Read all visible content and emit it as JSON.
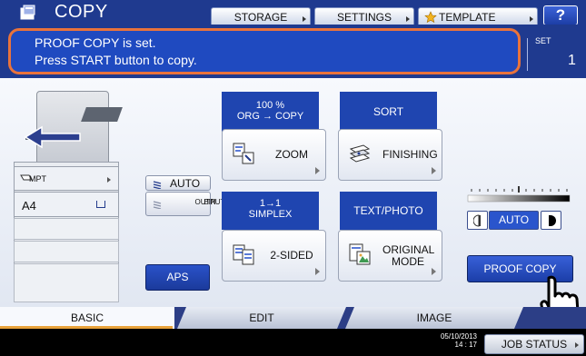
{
  "header": {
    "title": "COPY",
    "storage_label": "STORAGE",
    "settings_label": "SETTINGS",
    "template_label": "TEMPLATE",
    "help_label": "?"
  },
  "message": {
    "line1": "PROOF COPY is set.",
    "line2": "Press START button to copy.",
    "set_label": "SET",
    "set_count": "1"
  },
  "machine": {
    "tray_mpt": "MPT",
    "tray_a4": "A4",
    "paper_source": "AUTO",
    "output_line1": "OUTPUT",
    "output_line2": "BIN",
    "aps_label": "APS"
  },
  "functions": {
    "zoom_ratio": "100 %",
    "zoom_mode": "ORG  →  COPY",
    "zoom_label": "ZOOM",
    "sort_label": "SORT",
    "finishing_label": "FINISHING",
    "simplex_top": "1→1",
    "simplex_bottom": "SIMPLEX",
    "two_sided_label": "2-SIDED",
    "text_photo_label": "TEXT/PHOTO",
    "original_line1": "ORIGINAL",
    "original_line2": "MODE"
  },
  "density": {
    "auto_label": "AUTO",
    "level": 0.5
  },
  "proof_copy_label": "PROOF COPY",
  "tabs": [
    {
      "label": "BASIC",
      "active": true
    },
    {
      "label": "EDIT",
      "active": false
    },
    {
      "label": "IMAGE",
      "active": false
    }
  ],
  "status": {
    "date": "05/10/2013",
    "time": "14 : 17",
    "job_status_label": "JOB STATUS"
  },
  "colors": {
    "header_blue": "#1f3a8f",
    "highlight_orange": "#e9733c",
    "active_blue": "#2a55cc"
  }
}
